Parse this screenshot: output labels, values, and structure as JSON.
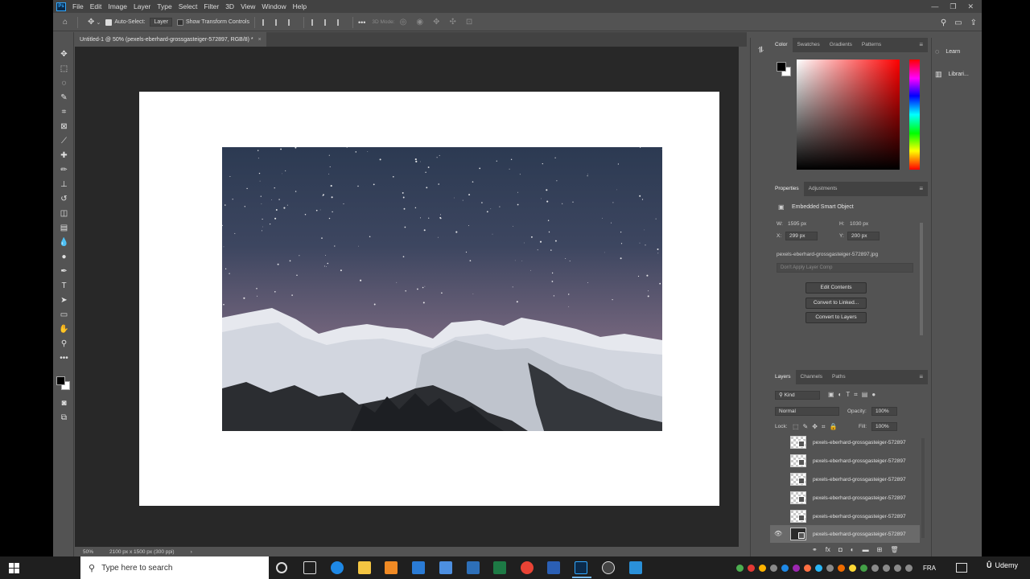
{
  "app": {
    "logo": "Ps"
  },
  "menu": [
    "File",
    "Edit",
    "Image",
    "Layer",
    "Type",
    "Select",
    "Filter",
    "3D",
    "View",
    "Window",
    "Help"
  ],
  "options": {
    "auto_select_label": "Auto-Select:",
    "auto_select_value": "Layer",
    "transform_label": "Show Transform Controls",
    "three_d_label": "3D Mode:",
    "more": "•••"
  },
  "document": {
    "tab_title": "Untitled-1 @ 50% (pexels-eberhard-grossgasteiger-572897, RGB/8) *",
    "zoom": "50%",
    "doc_info": "2100 px x 1500 px (300 ppi)"
  },
  "color_panel": {
    "tabs": [
      "Color",
      "Swatches",
      "Gradients",
      "Patterns"
    ]
  },
  "properties": {
    "tabs": [
      "Properties",
      "Adjustments"
    ],
    "type": "Embedded Smart Object",
    "w_label": "W:",
    "w": "1595 px",
    "h_label": "H:",
    "h": "1030 px",
    "x_label": "X:",
    "x": "299 px",
    "y_label": "Y:",
    "y": "200 px",
    "filename": "pexels-eberhard-grossgasteiger-572897.jpg",
    "layer_comp": "Don't Apply Layer Comp",
    "edit_contents": "Edit Contents",
    "convert_linked": "Convert to Linked...",
    "convert_layers": "Convert to Layers"
  },
  "layers_panel": {
    "tabs": [
      "Layers",
      "Channels",
      "Paths"
    ],
    "filter_kind": "Kind",
    "blend_mode": "Normal",
    "opacity_label": "Opacity:",
    "opacity": "100%",
    "lock_label": "Lock:",
    "fill_label": "Fill:",
    "fill": "100%",
    "layers": [
      "pexels-eberhard-grossgasteiger-572897",
      "pexels-eberhard-grossgasteiger-572897",
      "pexels-eberhard-grossgasteiger-572897",
      "pexels-eberhard-grossgasteiger-572897",
      "pexels-eberhard-grossgasteiger-572897",
      "pexels-eberhard-grossgasteiger-572897"
    ]
  },
  "learn_panel": {
    "learn": "Learn",
    "libraries": "Librari..."
  },
  "taskbar": {
    "search_placeholder": "Type here to search",
    "language": "FRA",
    "watermark": "Udemy"
  },
  "colors": {
    "app_bg": "#535353",
    "canvas_bg": "#282828",
    "accent": "#31a8ff"
  }
}
